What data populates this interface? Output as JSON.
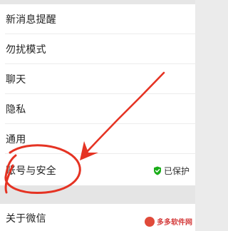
{
  "settings": {
    "items": [
      {
        "label": "新消息提醒"
      },
      {
        "label": "勿扰模式"
      },
      {
        "label": "聊天"
      },
      {
        "label": "隐私"
      },
      {
        "label": "通用"
      },
      {
        "label": "账号与安全",
        "status": "已保护"
      }
    ],
    "about_label": "关于微信"
  },
  "annotation": {
    "color": "#e53323"
  },
  "colors": {
    "accent": "#1aad19"
  },
  "watermark": {
    "text": "多多软件网"
  }
}
